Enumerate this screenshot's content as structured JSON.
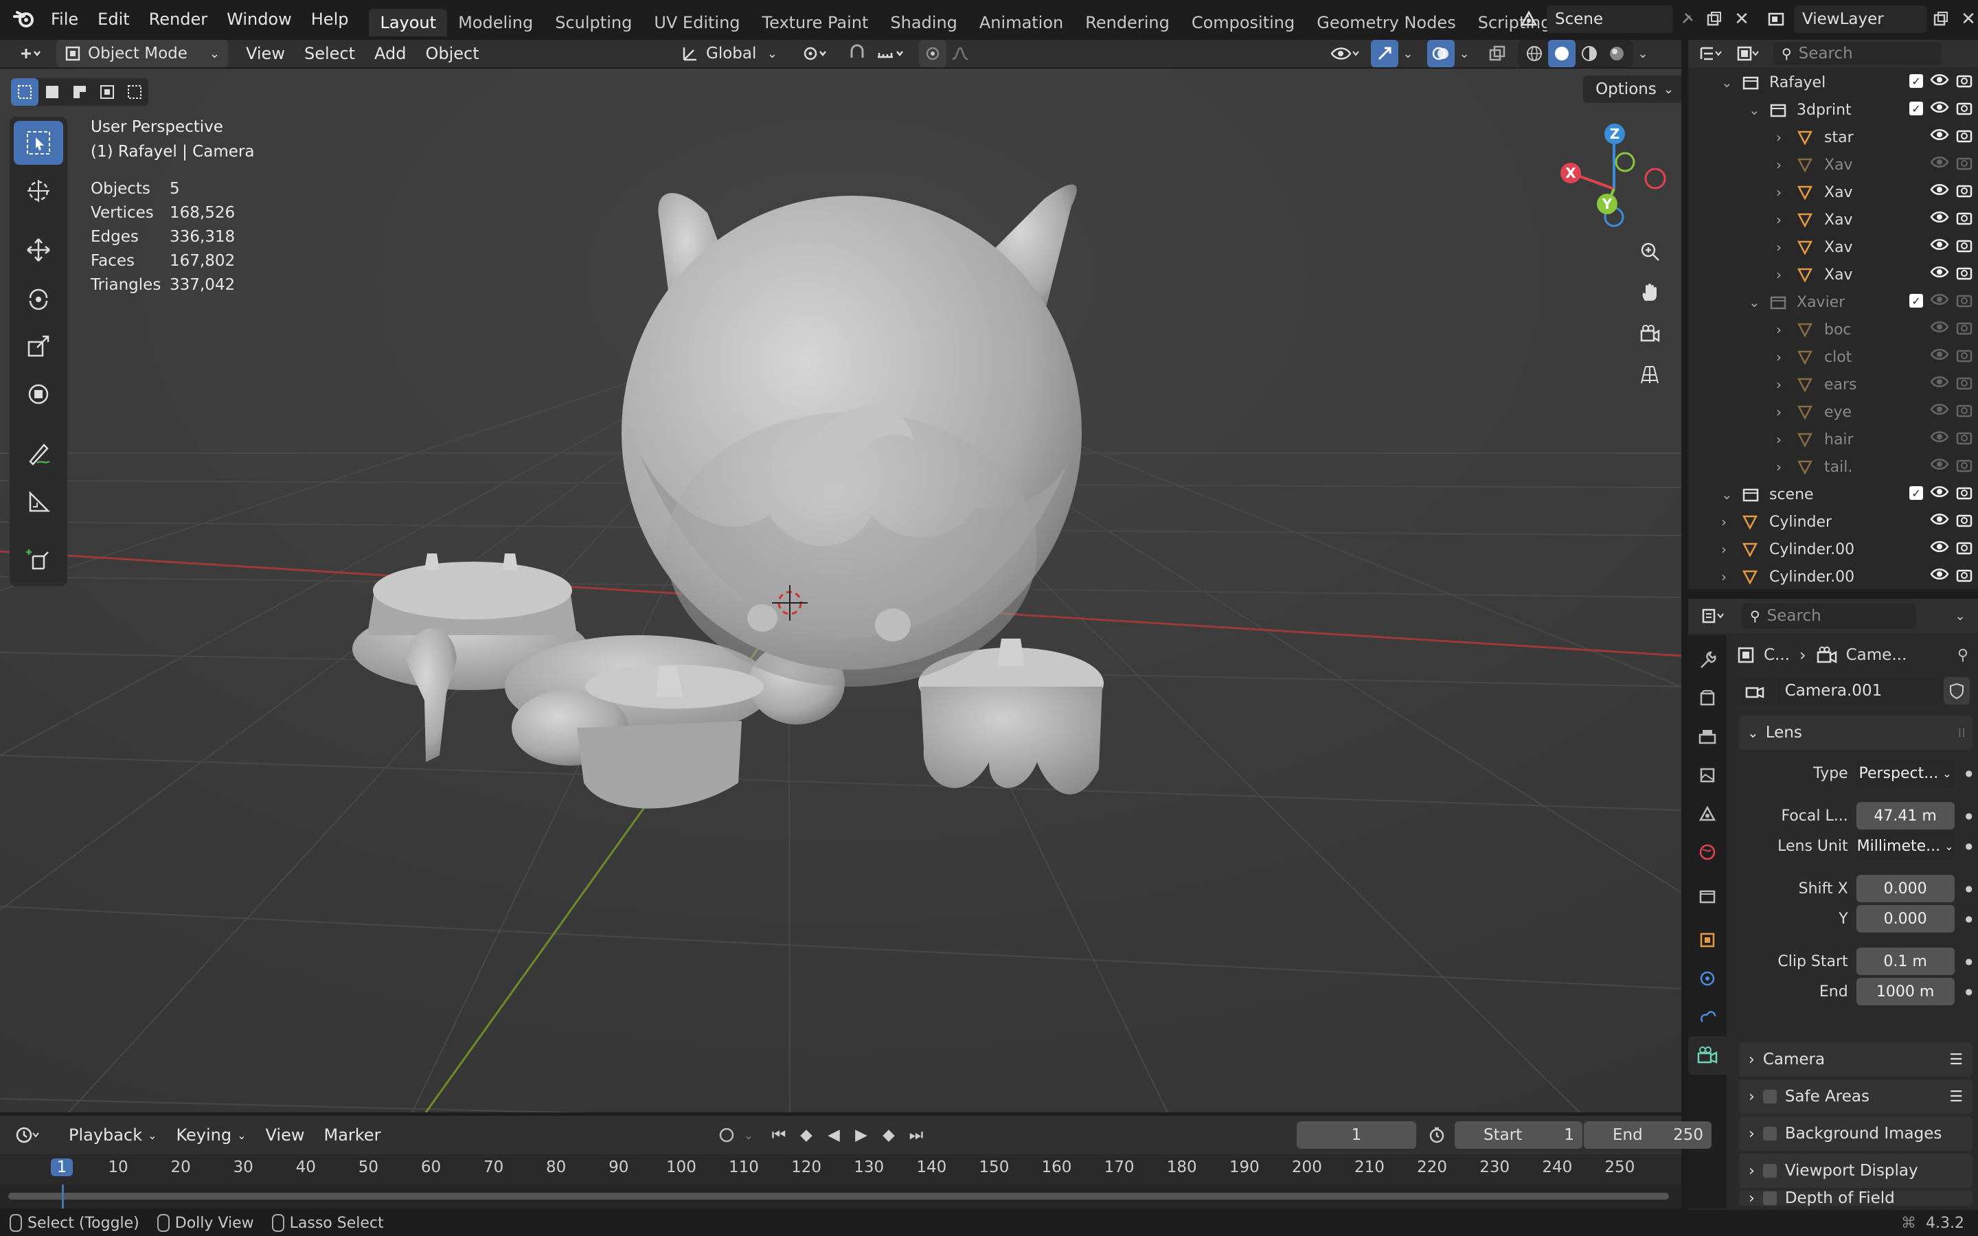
{
  "topbar": {
    "menus": [
      "File",
      "Edit",
      "Render",
      "Window",
      "Help"
    ],
    "workspaces": [
      "Layout",
      "Modeling",
      "Sculpting",
      "UV Editing",
      "Texture Paint",
      "Shading",
      "Animation",
      "Rendering",
      "Compositing",
      "Geometry Nodes",
      "Scripting"
    ],
    "active_workspace": "Layout",
    "scene_name": "Scene",
    "viewlayer_name": "ViewLayer"
  },
  "viewport_header": {
    "mode": "Object Mode",
    "menus": [
      "View",
      "Select",
      "Add",
      "Object"
    ],
    "transform_orientation": "Global",
    "options_label": "Options"
  },
  "viewport": {
    "perspective": "User Perspective",
    "context": "(1) Rafayel | Camera",
    "stats": [
      {
        "label": "Objects",
        "value": "5"
      },
      {
        "label": "Vertices",
        "value": "168,526"
      },
      {
        "label": "Edges",
        "value": "336,318"
      },
      {
        "label": "Faces",
        "value": "167,802"
      },
      {
        "label": "Triangles",
        "value": "337,042"
      }
    ],
    "gizmo": {
      "x": "X",
      "y": "Y",
      "z": "Z"
    }
  },
  "outliner": {
    "search_placeholder": "Search",
    "rows": [
      {
        "indent": 2,
        "kind": "collection",
        "label": "Rafayel",
        "dim": false,
        "checkbox": true
      },
      {
        "indent": 3,
        "kind": "collection",
        "label": "3dprint",
        "dim": false,
        "checkbox": true
      },
      {
        "indent": 4,
        "kind": "mesh",
        "label": "star",
        "dim": false
      },
      {
        "indent": 4,
        "kind": "mesh",
        "label": "Xav",
        "dim": true
      },
      {
        "indent": 4,
        "kind": "mesh",
        "label": "Xav",
        "dim": false
      },
      {
        "indent": 4,
        "kind": "mesh",
        "label": "Xav",
        "dim": false
      },
      {
        "indent": 4,
        "kind": "mesh",
        "label": "Xav",
        "dim": false
      },
      {
        "indent": 4,
        "kind": "mesh",
        "label": "Xav",
        "dim": false
      },
      {
        "indent": 3,
        "kind": "collection",
        "label": "Xavier",
        "dim": true,
        "checkbox": true
      },
      {
        "indent": 4,
        "kind": "mesh",
        "label": "boc",
        "dim": true
      },
      {
        "indent": 4,
        "kind": "mesh",
        "label": "clot",
        "dim": true
      },
      {
        "indent": 4,
        "kind": "mesh",
        "label": "ears",
        "dim": true
      },
      {
        "indent": 4,
        "kind": "mesh",
        "label": "eye",
        "dim": true
      },
      {
        "indent": 4,
        "kind": "mesh",
        "label": "hair",
        "dim": true
      },
      {
        "indent": 4,
        "kind": "mesh",
        "label": "tail.",
        "dim": true
      },
      {
        "indent": 2,
        "kind": "collection",
        "label": "scene",
        "dim": false,
        "checkbox": true
      },
      {
        "indent": 2,
        "kind": "mesh",
        "label": "Cylinder",
        "dim": false
      },
      {
        "indent": 2,
        "kind": "mesh",
        "label": "Cylinder.00",
        "dim": false
      },
      {
        "indent": 2,
        "kind": "mesh",
        "label": "Cylinder.00",
        "dim": false
      }
    ]
  },
  "properties": {
    "search_placeholder": "Search",
    "breadcrumb_object": "C...",
    "breadcrumb_data": "Came...",
    "datablock_name": "Camera.001",
    "lens_panel": "Lens",
    "fields": [
      {
        "label": "Type",
        "value": "Perspect...",
        "kind": "dropdown"
      },
      {
        "label": "Focal L...",
        "value": "47.41 m",
        "kind": "number"
      },
      {
        "label": "Lens Unit",
        "value": "Millimete...",
        "kind": "dropdown"
      },
      {
        "label": "Shift X",
        "value": "0.000",
        "kind": "number"
      },
      {
        "label": "Y",
        "value": "0.000",
        "kind": "number"
      },
      {
        "label": "Clip Start",
        "value": "0.1 m",
        "kind": "number"
      },
      {
        "label": "End",
        "value": "1000 m",
        "kind": "number"
      }
    ],
    "subpanels": [
      "Camera",
      "Safe Areas",
      "Background Images",
      "Viewport Display",
      "Depth of Field"
    ]
  },
  "timeline": {
    "menus": [
      "Playback",
      "Keying",
      "View",
      "Marker"
    ],
    "current_frame": "1",
    "start_label": "Start",
    "start_value": "1",
    "end_label": "End",
    "end_value": "250",
    "ticks": [
      "1",
      "10",
      "20",
      "30",
      "40",
      "50",
      "60",
      "70",
      "80",
      "90",
      "100",
      "110",
      "120",
      "130",
      "140",
      "150",
      "160",
      "170",
      "180",
      "190",
      "200",
      "210",
      "220",
      "230",
      "240",
      "250"
    ]
  },
  "statusbar": {
    "hints": [
      "Select (Toggle)",
      "Dolly View",
      "Lasso Select"
    ],
    "version": "4.3.2"
  },
  "colors": {
    "accent": "#4772b3",
    "x_axis": "#e04352",
    "y_axis": "#8bc73a",
    "z_axis": "#3b8dd9",
    "mesh_icon": "#e59a43",
    "camera_icon": "#6fd1b5"
  }
}
